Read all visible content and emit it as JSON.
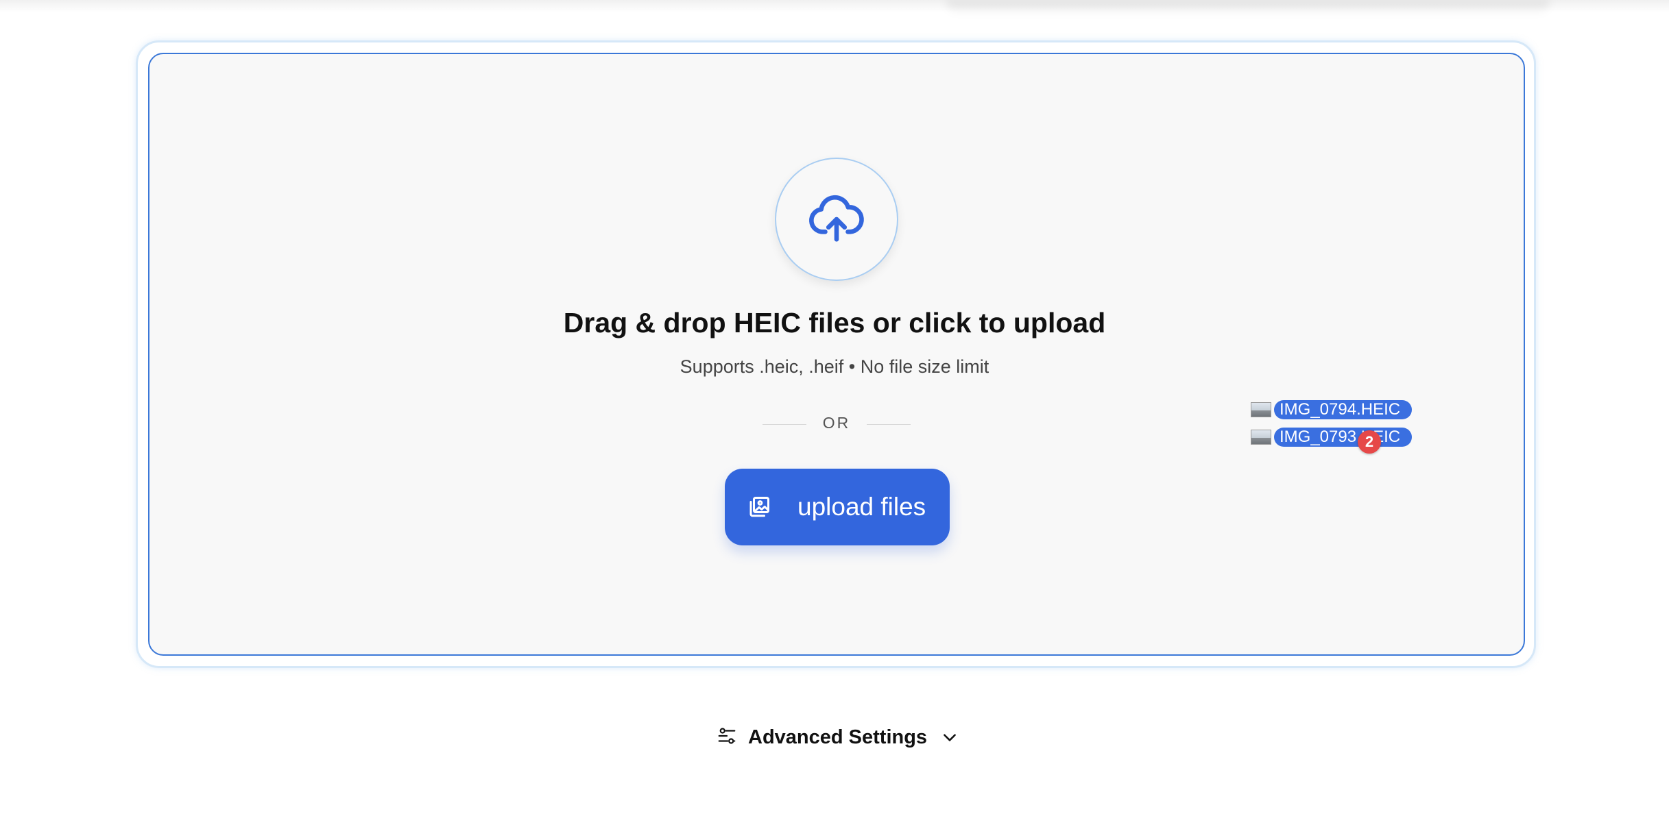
{
  "dropzone": {
    "title": "Drag & drop HEIC files or click to upload",
    "subtitle": "Supports .heic, .heif • No file size limit",
    "divider_text": "OR",
    "upload_button_label": "upload files",
    "upload_icon": "cloud-upload-icon",
    "button_icon": "image-gallery-icon"
  },
  "drag_preview": {
    "files": [
      "IMG_0794.HEIC",
      "IMG_0793.HEIC"
    ],
    "count_badge": "2"
  },
  "settings": {
    "label": "Advanced Settings",
    "icon": "sliders-icon",
    "expand_icon": "chevron-down-icon"
  },
  "colors": {
    "accent": "#3366dd",
    "drop_border": "#3b78d8",
    "badge": "#e64848",
    "drop_background": "#f8f8f8"
  }
}
